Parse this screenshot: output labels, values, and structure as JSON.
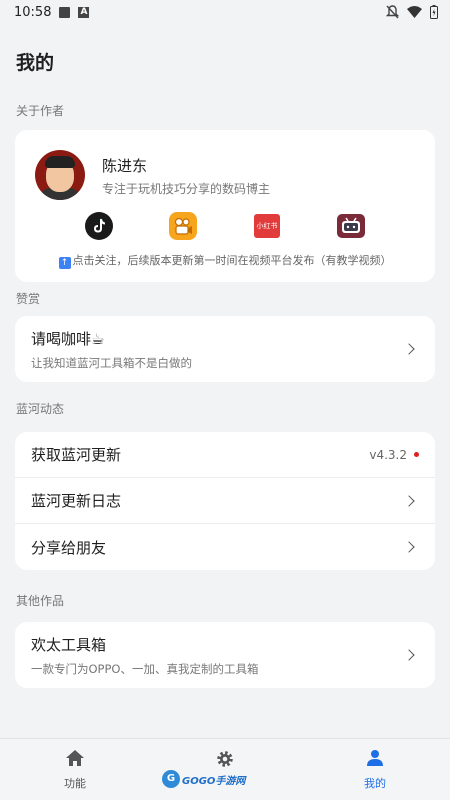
{
  "status": {
    "time": "10:58"
  },
  "page": {
    "title": "我的"
  },
  "author": {
    "section_label": "关于作者",
    "name": "陈进东",
    "desc": "专注于玩机技巧分享的数码博主",
    "follow_note": "点击关注，后续版本更新第一时间在视频平台发布（有教学视频）",
    "socials": [
      "tiktok-icon",
      "kuaishou-icon",
      "xiaohongshu-icon",
      "bilibili-icon"
    ],
    "xhs_label": "小红书"
  },
  "donate": {
    "section_label": "赞赏",
    "title": "请喝咖啡☕",
    "sub": "让我知道蓝河工具箱不是白做的"
  },
  "updates": {
    "section_label": "蓝河动态",
    "items": [
      {
        "title": "获取蓝河更新",
        "version": "v4.3.2"
      },
      {
        "title": "蓝河更新日志"
      },
      {
        "title": "分享给朋友"
      }
    ]
  },
  "other": {
    "section_label": "其他作品",
    "title": "欢太工具箱",
    "sub": "一款专门为OPPO、一加、真我定制的工具箱"
  },
  "nav": {
    "items": [
      {
        "label": "功能",
        "icon": "home-icon"
      },
      {
        "label": "",
        "icon": "gear-icon"
      },
      {
        "label": "我的",
        "icon": "person-icon"
      }
    ]
  },
  "watermark": {
    "text": "GOGO手游网"
  },
  "colors": {
    "accent": "#1e6fe6",
    "badge": "#e02020"
  }
}
